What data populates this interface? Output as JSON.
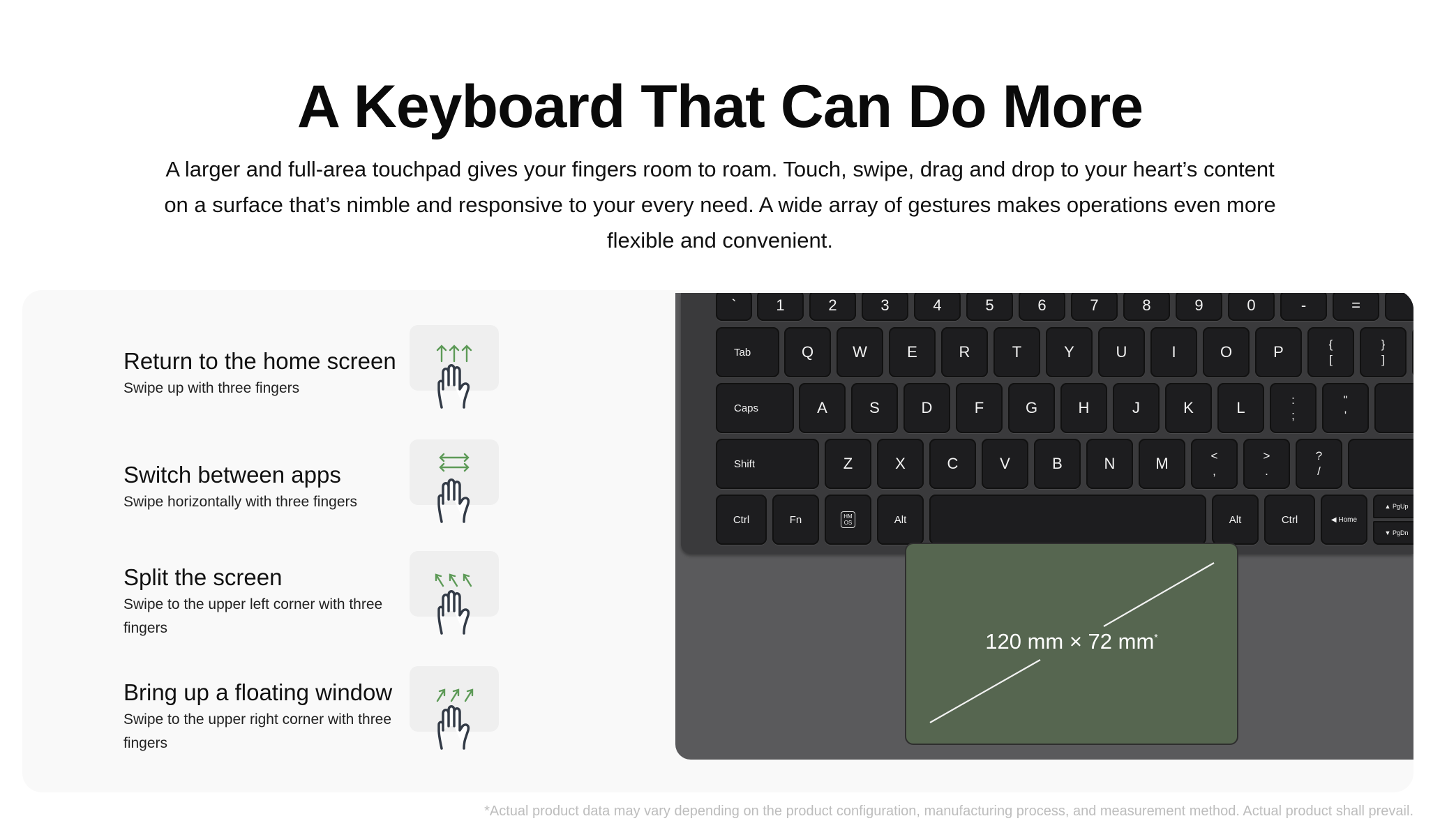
{
  "header": {
    "title": "A Keyboard That Can Do More",
    "intro": "A larger and full-area touchpad gives your fingers room to roam. Touch, swipe, drag and drop to your heart’s content on a surface that’s nimble and responsive to your every need. A wide array of gestures makes operations even more flexible and convenient."
  },
  "gestures": [
    {
      "title": "Return to the home screen",
      "description": "Swipe up with three fingers",
      "icon": "three-finger-swipe-up-icon"
    },
    {
      "title": "Switch between apps",
      "description": "Swipe horizontally with three fingers",
      "icon": "three-finger-swipe-horizontal-icon"
    },
    {
      "title": "Split the screen",
      "description": "Swipe to the upper left corner with three fingers",
      "icon": "three-finger-swipe-upper-left-icon"
    },
    {
      "title": "Bring up a floating window",
      "description": "Swipe to the upper right corner with three fingers",
      "icon": "three-finger-swipe-upper-right-icon"
    }
  ],
  "keyboard": {
    "rows": [
      [
        "`",
        "1",
        "2",
        "3",
        "4",
        "5",
        "6",
        "7",
        "8",
        "9",
        "0",
        "-",
        "=",
        ""
      ],
      [
        "Tab",
        "Q",
        "W",
        "E",
        "R",
        "T",
        "Y",
        "U",
        "I",
        "O",
        "P",
        "{ [",
        "} ]",
        ""
      ],
      [
        "Caps",
        "A",
        "S",
        "D",
        "F",
        "G",
        "H",
        "J",
        "K",
        "L",
        ": ;",
        "\" '",
        ""
      ],
      [
        "Shift",
        "Z",
        "X",
        "C",
        "V",
        "B",
        "N",
        "M",
        "< ,",
        "> .",
        "? /",
        ""
      ],
      [
        "Ctrl",
        "Fn",
        "HMOS",
        "Alt",
        "",
        "Alt",
        "Ctrl",
        "◀ Home",
        "▲ PgUp / ▼ PgDn",
        ""
      ]
    ],
    "touchpad_label": "120 mm × 72 mm",
    "touchpad_label_mark": "*"
  },
  "colors": {
    "accent_green": "#5d9a57",
    "touchpad_green": "#566650",
    "icon_stroke": "#333b47"
  },
  "footnote": "*Actual product data may vary depending on the product configuration, manufacturing process, and measurement method. Actual product shall prevail."
}
